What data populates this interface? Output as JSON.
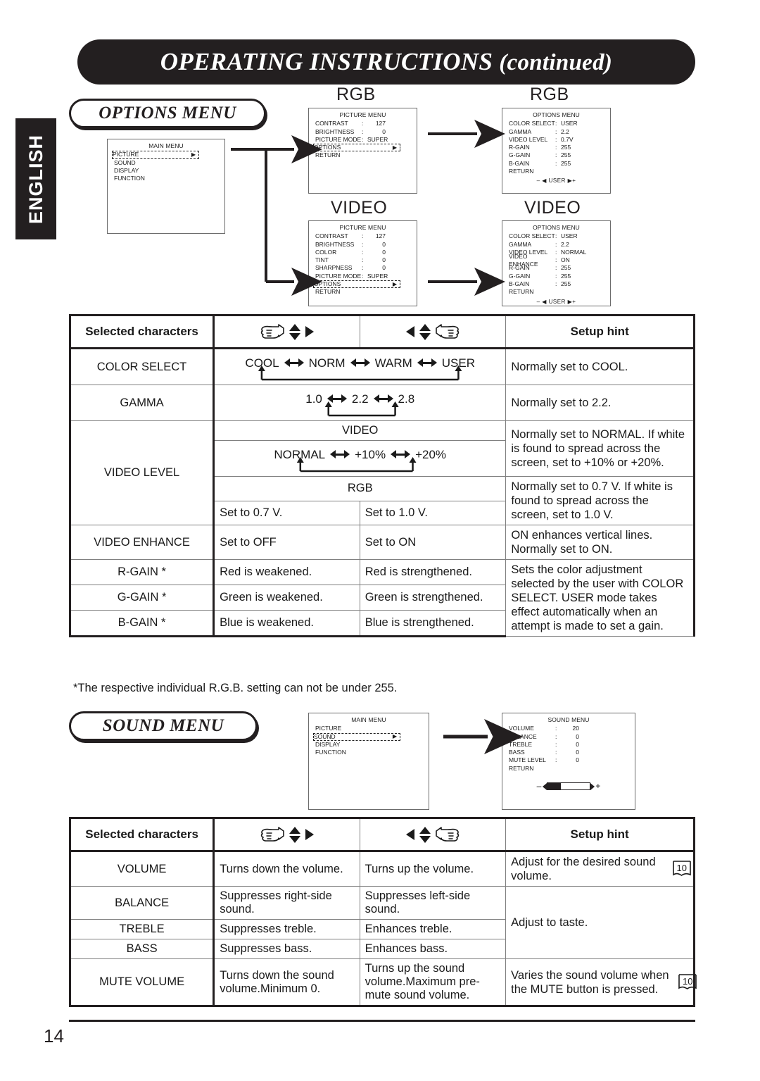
{
  "page": {
    "banner_title_main": "OPERATING INSTRUCTIONS",
    "banner_title_suffix": "(continued)",
    "language_tab": "ENGLISH",
    "page_number": "14"
  },
  "sections": {
    "options_menu_title": "OPTIONS MENU",
    "sound_menu_title": "SOUND MENU"
  },
  "screen_labels": {
    "rgb_1": "RGB",
    "rgb_2": "RGB",
    "video_1": "VIDEO",
    "video_2": "VIDEO"
  },
  "osd": {
    "main_menu_1": {
      "title": "MAIN MENU",
      "items": [
        "PICTURE",
        "SOUND",
        "DISPLAY",
        "FUNCTION"
      ],
      "highlighted": "PICTURE"
    },
    "picture_menu_rgb": {
      "title": "PICTURE MENU",
      "rows": [
        {
          "label": "CONTRAST",
          "sep": ":",
          "value": "127"
        },
        {
          "label": "BRIGHTNESS",
          "sep": ":",
          "value": "0"
        },
        {
          "label": "PICTURE MODE",
          "sep": ":",
          "value": "SUPER"
        }
      ],
      "highlighted": "OPTIONS",
      "return": "RETURN"
    },
    "options_menu_rgb": {
      "title": "OPTIONS MENU",
      "rows": [
        {
          "label": "COLOR SELECT",
          "sep": ":",
          "value": "USER"
        },
        {
          "label": "GAMMA",
          "sep": ":",
          "value": "2.2"
        },
        {
          "label": "VIDEO LEVEL",
          "sep": ":",
          "value": "0.7V"
        },
        {
          "label": "R-GAIN",
          "sep": ":",
          "value": "255"
        },
        {
          "label": "G-GAIN",
          "sep": ":",
          "value": "255"
        },
        {
          "label": "B-GAIN",
          "sep": ":",
          "value": "255"
        }
      ],
      "return": "RETURN",
      "footer": "USER"
    },
    "picture_menu_video": {
      "title": "PICTURE MENU",
      "rows": [
        {
          "label": "CONTRAST",
          "sep": ":",
          "value": "127"
        },
        {
          "label": "BRIGHTNESS",
          "sep": ":",
          "value": "0"
        },
        {
          "label": "COLOR",
          "sep": ":",
          "value": "0"
        },
        {
          "label": "TINT",
          "sep": ":",
          "value": "0"
        },
        {
          "label": "SHARPNESS",
          "sep": ":",
          "value": "0"
        },
        {
          "label": "PICTURE MODE",
          "sep": ":",
          "value": "SUPER"
        }
      ],
      "highlighted": "OPTIONS",
      "return": "RETURN"
    },
    "options_menu_video": {
      "title": "OPTIONS MENU",
      "rows": [
        {
          "label": "COLOR SELECT",
          "sep": ":",
          "value": "USER"
        },
        {
          "label": "GAMMA",
          "sep": ":",
          "value": "2.2"
        },
        {
          "label": "VIDEO LEVEL",
          "sep": ":",
          "value": "NORMAL"
        },
        {
          "label": "VIDEO ENHANCE",
          "sep": ":",
          "value": "ON"
        },
        {
          "label": "R-GAIN",
          "sep": ":",
          "value": "255"
        },
        {
          "label": "G-GAIN",
          "sep": ":",
          "value": "255"
        },
        {
          "label": "B-GAIN",
          "sep": ":",
          "value": "255"
        }
      ],
      "return": "RETURN",
      "footer": "USER"
    },
    "main_menu_2": {
      "title": "MAIN MENU",
      "items": [
        "PICTURE",
        "SOUND",
        "DISPLAY",
        "FUNCTION"
      ],
      "highlighted": "SOUND"
    },
    "sound_menu": {
      "title": "SOUND MENU",
      "rows": [
        {
          "label": "VOLUME",
          "sep": ":",
          "value": "20"
        },
        {
          "label": "BALANCE",
          "sep": ":",
          "value": "0"
        },
        {
          "label": "TREBLE",
          "sep": ":",
          "value": "0"
        },
        {
          "label": "BASS",
          "sep": ":",
          "value": "0"
        },
        {
          "label": "MUTE LEVEL",
          "sep": ":",
          "value": "0"
        }
      ],
      "return": "RETURN",
      "slider_minus": "–",
      "slider_plus": "+"
    }
  },
  "options_table": {
    "headers": {
      "col_name": "Selected characters",
      "col_left_icon": "hand-left-arrows-icon",
      "col_right_icon": "hand-right-arrows-icon",
      "col_hint": "Setup hint"
    },
    "rows": [
      {
        "name": "COLOR SELECT",
        "type": "chain",
        "chain": [
          "COOL",
          "NORM",
          "WARM",
          "USER"
        ],
        "hint": "Normally set to COOL."
      },
      {
        "name": "GAMMA",
        "type": "chain",
        "chain": [
          "1.0",
          "2.2",
          "2.8"
        ],
        "hint": "Normally set to 2.2."
      },
      {
        "name": "VIDEO LEVEL",
        "type": "split",
        "video_label": "VIDEO",
        "video_chain": [
          "NORMAL",
          "+10%",
          "+20%"
        ],
        "video_hint": "Normally set to NORMAL. If white is found to spread across the screen, set to +10% or +20%.",
        "rgb_label": "RGB",
        "rgb_left": "Set to 0.7 V.",
        "rgb_right": "Set to 1.0 V.",
        "rgb_hint": "Normally set to 0.7 V. If white is found to spread across the screen, set to 1.0 V."
      },
      {
        "name": "VIDEO ENHANCE",
        "type": "pair",
        "left": "Set to OFF",
        "right": "Set to ON",
        "hint": "ON enhances vertical lines. Normally set to ON."
      },
      {
        "name": "R-GAIN *",
        "type": "pair",
        "left": "Red is weakened.",
        "right": "Red is strengthened."
      },
      {
        "name": "G-GAIN *",
        "type": "pair",
        "left": "Green is weakened.",
        "right": "Green is strengthened."
      },
      {
        "name": "B-GAIN *",
        "type": "pair",
        "left": "Blue is weakened.",
        "right": "Blue is strengthened."
      }
    ],
    "gain_hint": "Sets the color adjustment selected by the user with COLOR SELECT.\nUSER mode takes effect automatically when an attempt is made to set a gain.",
    "gain_hint_line1": "Sets the color adjustment selected by the user with COLOR SELECT.",
    "gain_hint_line2": "USER mode takes effect automatically when an attempt is made to set a gain.",
    "footnote": "*The respective individual R.G.B. setting can not be under 255."
  },
  "sound_table": {
    "headers": {
      "col_name": "Selected characters",
      "col_left_icon": "hand-left-arrows-icon",
      "col_right_icon": "hand-right-arrows-icon",
      "col_hint": "Setup hint"
    },
    "rows": [
      {
        "name": "VOLUME",
        "left": "Turns down the volume.",
        "right": "Turns up the volume.",
        "hint": "Adjust for the desired sound volume.",
        "page_ref": "10"
      },
      {
        "name": "BALANCE",
        "left": "Suppresses right-side sound.",
        "right": "Suppresses left-side sound."
      },
      {
        "name": "TREBLE",
        "left": "Suppresses treble.",
        "right": "Enhances treble."
      },
      {
        "name": "BASS",
        "left": "Suppresses bass.",
        "right": "Enhances bass."
      },
      {
        "name": "MUTE VOLUME",
        "left": "Turns down the sound volume.Minimum 0.",
        "right": "Turns up the sound volume.Maximum pre-mute sound volume.",
        "hint": "Varies the sound volume when the MUTE button is pressed.",
        "page_ref": "10"
      }
    ],
    "taste_hint": "Adjust to taste."
  }
}
